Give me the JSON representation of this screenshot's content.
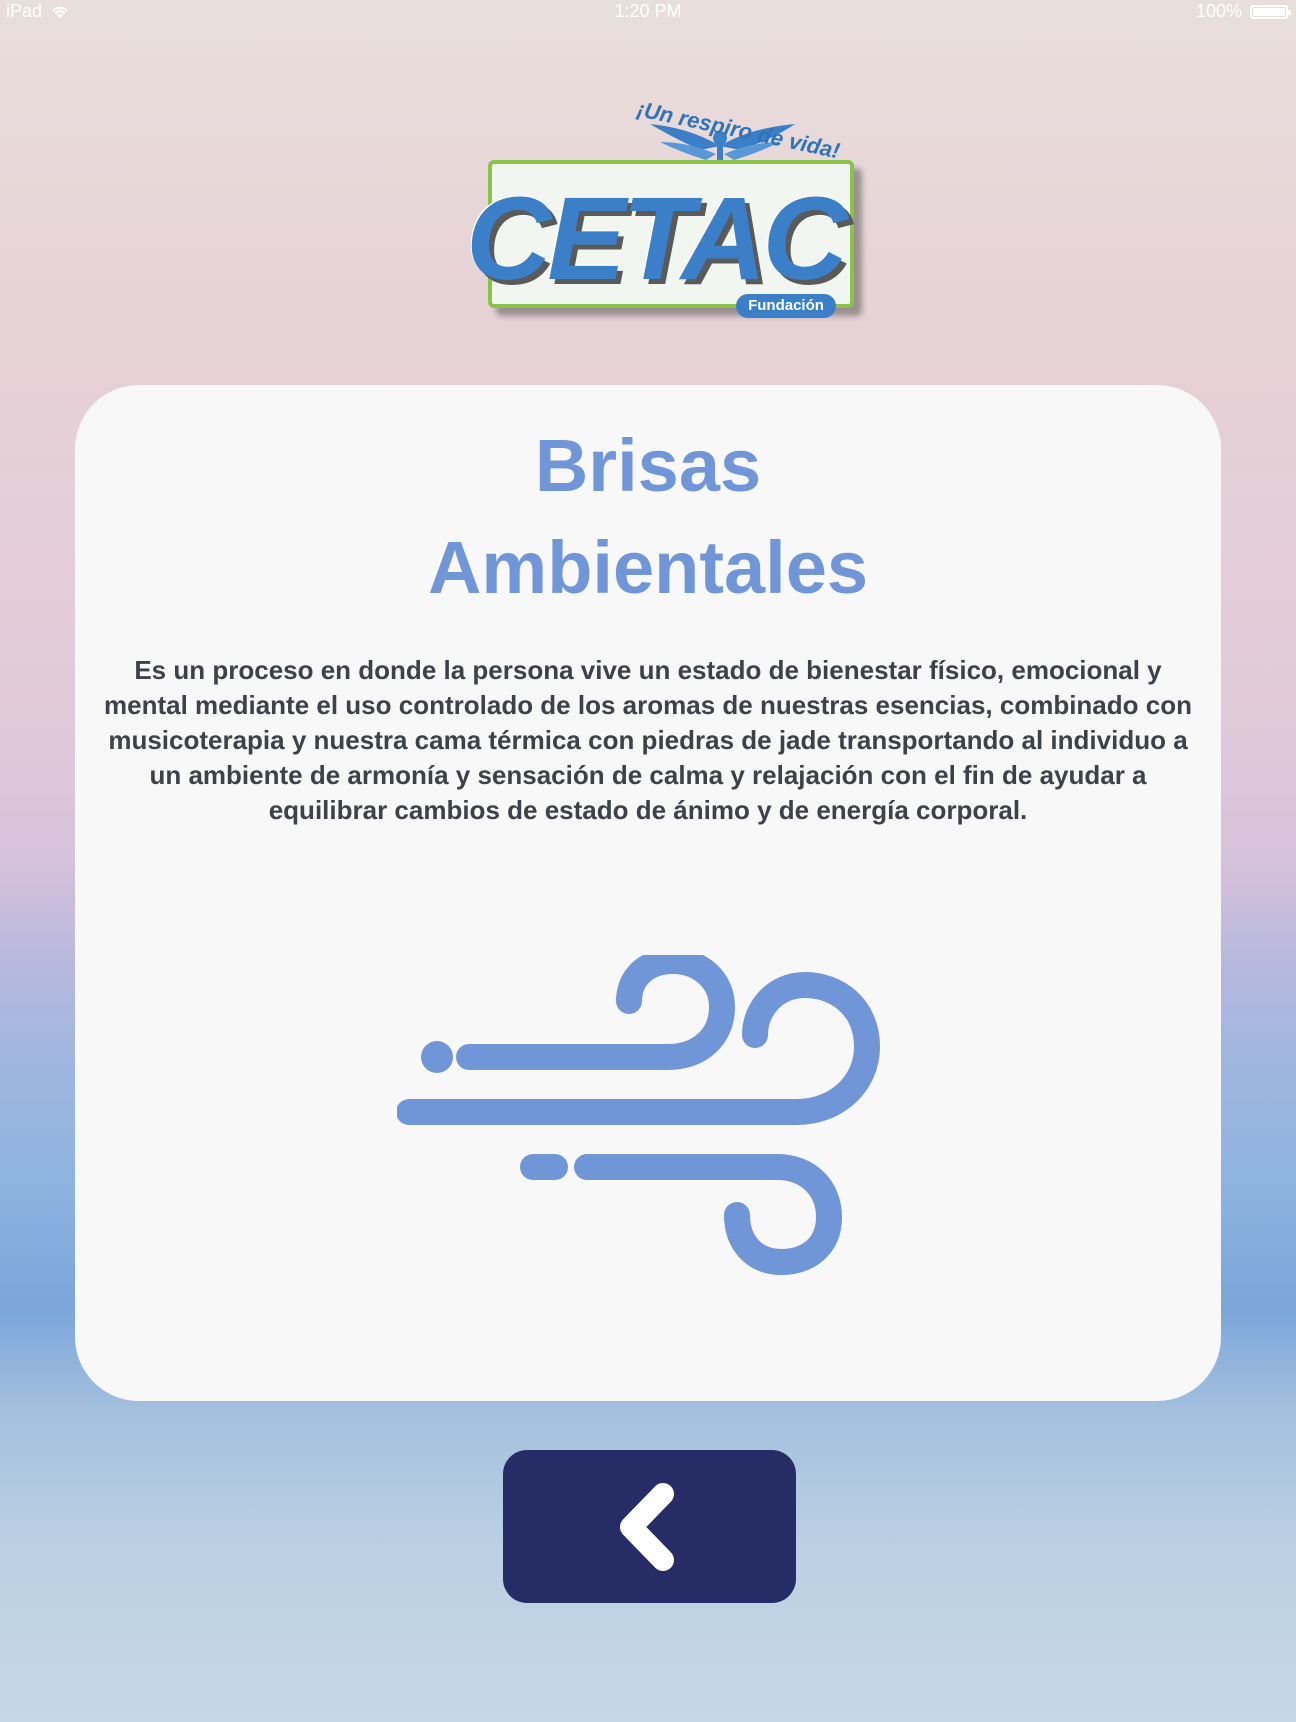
{
  "status_bar": {
    "device": "iPad",
    "time": "1:20 PM",
    "battery": "100%"
  },
  "logo": {
    "tagline": "¡Un respiro de vida!",
    "name": "CETAC",
    "subtitle": "Fundación"
  },
  "card": {
    "title_line1": "Brisas",
    "title_line2": "Ambientales",
    "description": "Es un proceso en donde la persona vive un estado de bienestar físico, emocional y mental mediante el uso controlado de los aromas de nuestras esencias, combinado con musicoterapia y nuestra cama térmica con piedras de jade transportando al individuo a un ambiente de armonía y sensación de calma y relajación con el fin de ayudar a equilibrar cambios de estado de ánimo y de energía corporal.",
    "icon": "wind-icon"
  },
  "back_button": {
    "icon": "chevron-left-icon"
  },
  "colors": {
    "accent": "#7196d8",
    "button": "#262c66",
    "card": "#f8f8f9",
    "text": "#3e4248",
    "logo_blue": "#3b7fc8",
    "logo_green": "#8bc34a"
  }
}
